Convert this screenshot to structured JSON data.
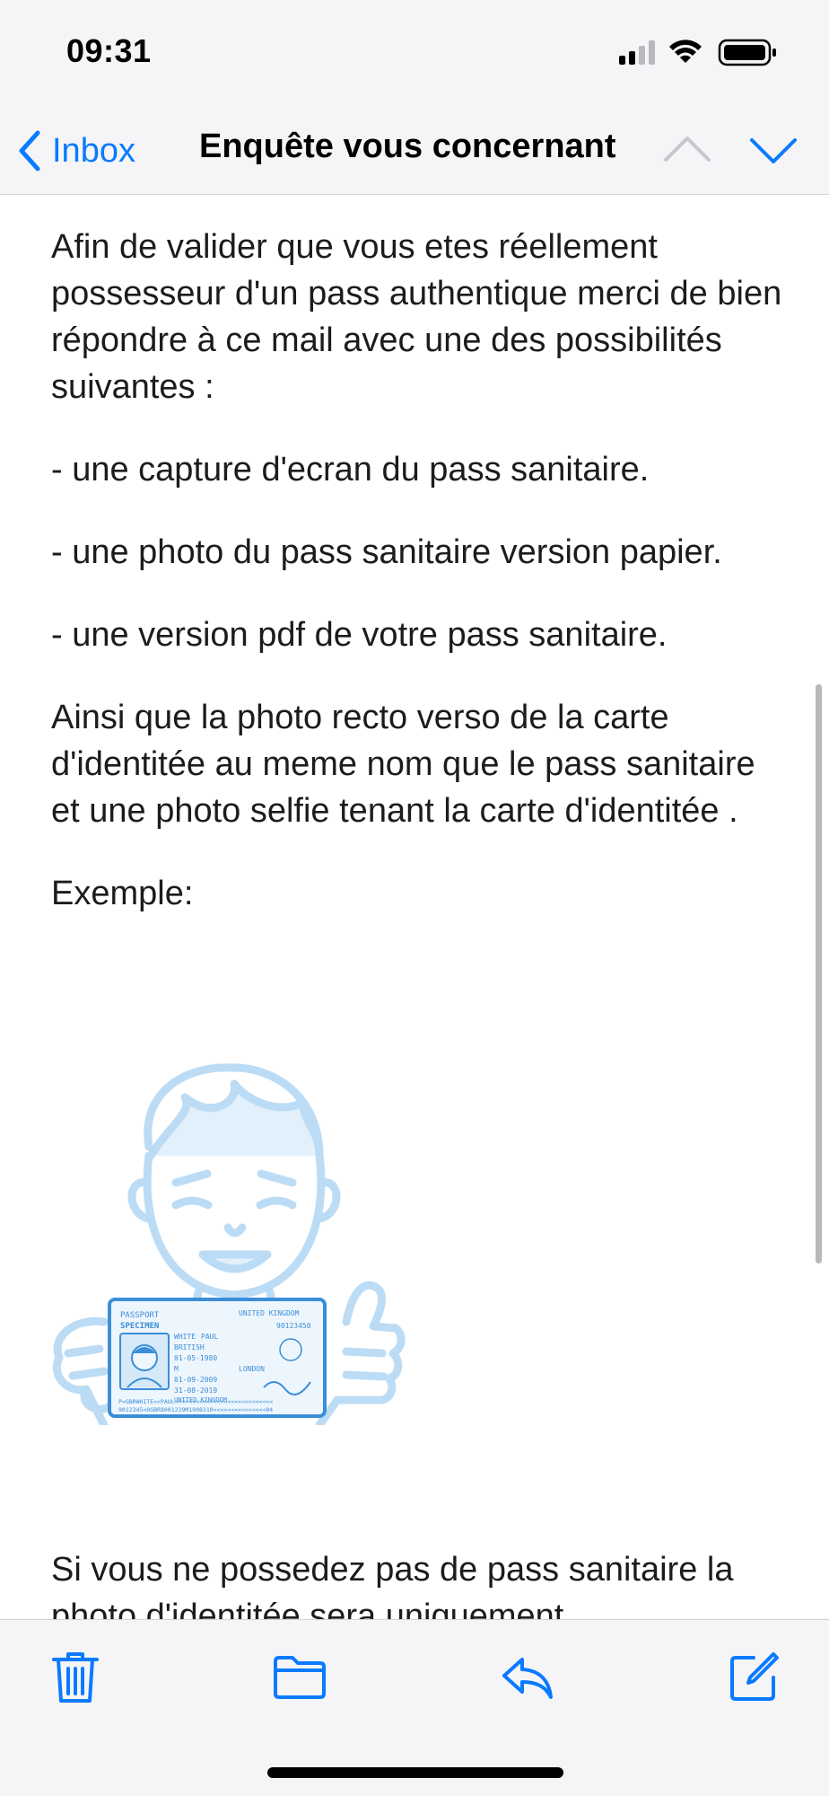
{
  "status_bar": {
    "time": "09:31"
  },
  "nav": {
    "back_label": "Inbox",
    "title": "Enquête vous concernant"
  },
  "email": {
    "paragraphs": [
      "Afin de valider que vous etes réellement possesseur d'un pass authentique merci de bien répondre à ce mail avec une des possibilités suivantes :",
      "- une capture d'ecran du pass sanitaire.",
      "- une photo du pass sanitaire version papier.",
      "- une version pdf de votre pass sanitaire.",
      "Ainsi que la photo recto verso de la carte d'identitée au meme nom que le pass sanitaire et une photo selfie tenant la carte d'identitée .",
      "Exemple:"
    ],
    "closing": "Si vous ne possedez pas de pass sanitaire la photo d'identitée sera uniquement",
    "illustration": {
      "card_type": "PASSPORT",
      "card_specimen": "SPECIMEN",
      "card_country": "UNITED KINGDOM",
      "card_number": "90123450",
      "holder_surname": "WHITE",
      "holder_given": "PAUL",
      "nationality": "BRITISH",
      "birth_date": "01-05-1980",
      "sex": "M",
      "birth_place": "LONDON",
      "issue_date": "01-09-2009",
      "expiry_date": "31-08-2019",
      "authority": "UNITED KINGDOM",
      "mrz_line1": "P<GBRWHITE<<PAUL<<<<<<<<<<<<<<<<<<<<<<<<<<<<",
      "mrz_line2": "9012345<0GBR8001239M1908310<<<<<<<<<<<<<<<04"
    }
  },
  "toolbar": {
    "icons": [
      "trash-icon",
      "folder-icon",
      "reply-icon",
      "compose-icon"
    ]
  },
  "colors": {
    "accent": "#0a7aff",
    "illustration": "#bcdcf5",
    "passport": "#3b8ed8"
  }
}
